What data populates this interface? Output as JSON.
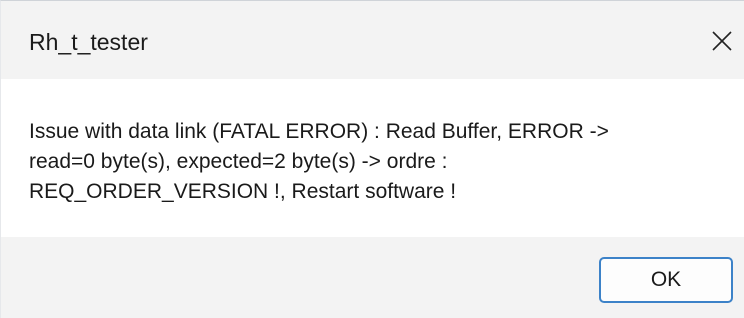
{
  "window": {
    "title": "Rh_t_tester",
    "close_icon": "close-icon"
  },
  "message": {
    "text": "Issue with data link (FATAL ERROR) : Read Buffer, ERROR ->\nread=0 byte(s), expected=2 byte(s) -> ordre :\nREQ_ORDER_VERSION !, Restart software !"
  },
  "buttons": {
    "ok_label": "OK"
  },
  "colors": {
    "titlebar_bg": "#f3f3f3",
    "body_bg": "#ffffff",
    "footer_bg": "#f3f3f3",
    "accent_border": "#3c82c8"
  }
}
